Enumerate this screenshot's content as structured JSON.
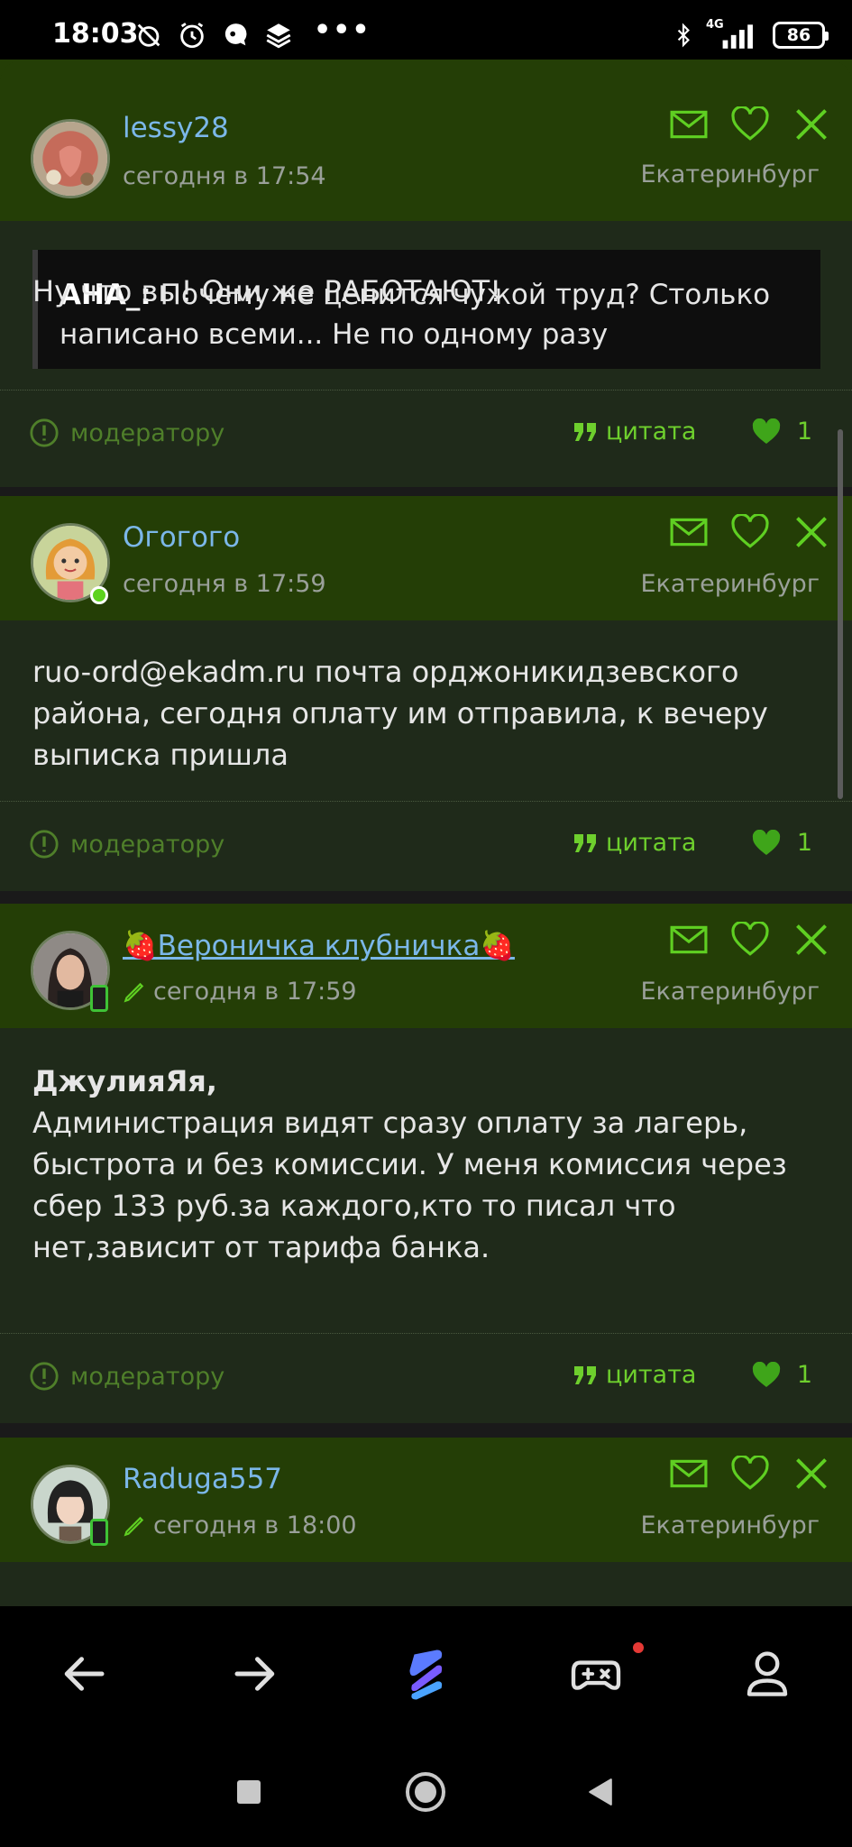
{
  "status_bar": {
    "time": "18:03",
    "network": "4G",
    "battery": "86"
  },
  "posts": [
    {
      "username": "lessy28",
      "date": "сегодня в 17:54",
      "city": "Екатеринбург",
      "quote_author": "АНА_:",
      "quote_text": " Почему не ценится чужой труд? Столько написано всеми... Не по одному разу",
      "text": "Ну что вы! Они же РАБОТАЮТ!",
      "moderator_label": "модератору",
      "cite_label": "цитата",
      "likes": "1"
    },
    {
      "username": "Огогого",
      "date": "сегодня в 17:59",
      "city": "Екатеринбург",
      "text": "ruo-ord@ekadm.ru почта орджоникидзевского района, сегодня оплату им отправила, к вечеру выписка пришла",
      "moderator_label": "модератору",
      "cite_label": "цитата",
      "likes": "1"
    },
    {
      "username": "🍓Вероничка клубничка🍓",
      "date": "сегодня в 17:59",
      "city": "Екатеринбург",
      "text_bold": "ДжулияЯя,",
      "text": "Администрация видят сразу оплату за лагерь, быстрота и без комиссии. У меня комиссия через сбер 133 руб.за каждого,кто то писал что нет,зависит от тарифа банка.",
      "moderator_label": "модератору",
      "cite_label": "цитата",
      "likes": "1"
    },
    {
      "username": "Raduga557",
      "date": "сегодня в 18:00",
      "city": "Екатеринбург"
    }
  ],
  "colors": {
    "header_bg": "#243e06",
    "body_bg": "#1f2a1a",
    "username": "#7bb7e9",
    "accent_green": "#6ecf2d"
  }
}
